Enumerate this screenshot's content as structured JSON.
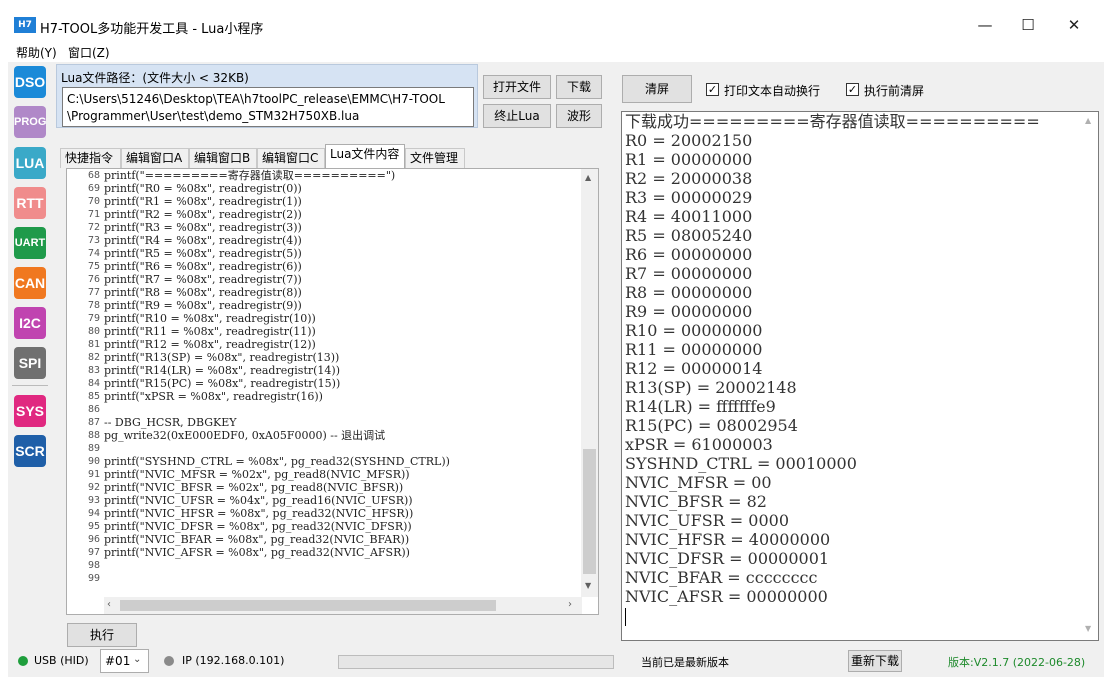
{
  "window": {
    "icon_text": "H7",
    "title": "H7-TOOL多功能开发工具 - Lua小程序",
    "minimize": "—",
    "maximize": "☐",
    "close": "✕"
  },
  "menu": {
    "help": "帮助(Y)",
    "window": "窗口(Z)"
  },
  "sidebar": [
    {
      "label": "DSO",
      "color": "#1b8ad8"
    },
    {
      "label": "PROG",
      "color": "#b088c8"
    },
    {
      "label": "LUA",
      "color": "#3aa9c8"
    },
    {
      "label": "RTT",
      "color": "#f08c8c"
    },
    {
      "label": "UART",
      "color": "#1f9a4a"
    },
    {
      "label": "CAN",
      "color": "#f07820"
    },
    {
      "label": "I2C",
      "color": "#c044b0"
    },
    {
      "label": "SPI",
      "color": "#707070"
    },
    {
      "label": "SYS",
      "color": "#e02880"
    },
    {
      "label": "SCR",
      "color": "#1f5fa8"
    }
  ],
  "lua_path": {
    "label": "Lua文件路径：(文件大小 < 32KB)",
    "line1": "C:\\Users\\51246\\Desktop\\TEA\\h7toolPC_release\\EMMC\\H7-TOOL",
    "line2": "\\Programmer\\User\\test\\demo_STM32H750XB.lua"
  },
  "buttons": {
    "open_file": "打开文件",
    "download": "下载",
    "stop_lua": "终止Lua",
    "waveform": "波形",
    "execute": "执行",
    "clear": "清屏",
    "redownload": "重新下载"
  },
  "tabs": [
    "快捷指令",
    "编辑窗口A",
    "编辑窗口B",
    "编辑窗口C",
    "Lua文件内容",
    "文件管理"
  ],
  "active_tab": 4,
  "code": {
    "line_numbers": [
      "68",
      "69",
      "70",
      "71",
      "72",
      "73",
      "74",
      "75",
      "76",
      "77",
      "78",
      "79",
      "80",
      "81",
      "82",
      "83",
      "84",
      "85",
      "86",
      "87",
      "88",
      "89",
      "90",
      "91",
      "92",
      "93",
      "94",
      "95",
      "96",
      "97",
      "98",
      "99"
    ],
    "lines": [
      "printf(\"=========寄存器值读取==========\")",
      "printf(\"R0 = %08x\", readregistr(0))",
      "printf(\"R1 = %08x\", readregistr(1))",
      "printf(\"R2 = %08x\", readregistr(2))",
      "printf(\"R3 = %08x\", readregistr(3))",
      "printf(\"R4 = %08x\", readregistr(4))",
      "printf(\"R5 = %08x\", readregistr(5))",
      "printf(\"R6 = %08x\", readregistr(6))",
      "printf(\"R7 = %08x\", readregistr(7))",
      "printf(\"R8 = %08x\", readregistr(8))",
      "printf(\"R9 = %08x\", readregistr(9))",
      "printf(\"R10 = %08x\", readregistr(10))",
      "printf(\"R11 = %08x\", readregistr(11))",
      "printf(\"R12 = %08x\", readregistr(12))",
      "printf(\"R13(SP) = %08x\", readregistr(13))",
      "printf(\"R14(LR) = %08x\", readregistr(14))",
      "printf(\"R15(PC) = %08x\", readregistr(15))",
      "printf(\"xPSR = %08x\", readregistr(16))",
      "",
      "-- DBG_HCSR, DBGKEY",
      "pg_write32(0xE000EDF0, 0xA05F0000) -- 退出调试",
      "",
      "printf(\"SYSHND_CTRL = %08x\", pg_read32(SYSHND_CTRL))",
      "printf(\"NVIC_MFSR = %02x\", pg_read8(NVIC_MFSR))",
      "printf(\"NVIC_BFSR = %02x\", pg_read8(NVIC_BFSR))",
      "printf(\"NVIC_UFSR = %04x\", pg_read16(NVIC_UFSR))",
      "printf(\"NVIC_HFSR = %08x\", pg_read32(NVIC_HFSR))",
      "printf(\"NVIC_DFSR = %08x\", pg_read32(NVIC_DFSR))",
      "printf(\"NVIC_BFAR = %08x\", pg_read32(NVIC_BFAR))",
      "printf(\"NVIC_AFSR = %08x\", pg_read32(NVIC_AFSR))",
      "",
      ""
    ]
  },
  "options": {
    "wrap_label": "打印文本自动换行",
    "wrap_checked": true,
    "clear_before_label": "执行前清屏",
    "clear_before_checked": true
  },
  "output_lines": [
    "下载成功=========寄存器值读取==========",
    "R0 = 20002150",
    "R1 = 00000000",
    "R2 = 20000038",
    "R3 = 00000029",
    "R4 = 40011000",
    "R5 = 08005240",
    "R6 = 00000000",
    "R7 = 00000000",
    "R8 = 00000000",
    "R9 = 00000000",
    "R10 = 00000000",
    "R11 = 00000000",
    "R12 = 00000014",
    "R13(SP) = 20002148",
    "R14(LR) = fffffffe9",
    "R15(PC) = 08002954",
    "xPSR = 61000003",
    "SYSHND_CTRL = 00010000",
    "NVIC_MFSR = 00",
    "NVIC_BFSR = 82",
    "NVIC_UFSR = 0000",
    "NVIC_HFSR = 40000000",
    "NVIC_DFSR = 00000001",
    "NVIC_BFAR = cccccccc",
    "NVIC_AFSR = 00000000"
  ],
  "status": {
    "usb_label": "USB (HID)",
    "usb_color": "#1e9e3c",
    "device_select": "#01",
    "ip_label": "IP (192.168.0.101)",
    "ip_color": "#8a8a8a",
    "update_status": "当前已是最新版本",
    "version": "版本:V2.1.7 (2022-06-28)",
    "version_color": "#1e8a2c"
  }
}
